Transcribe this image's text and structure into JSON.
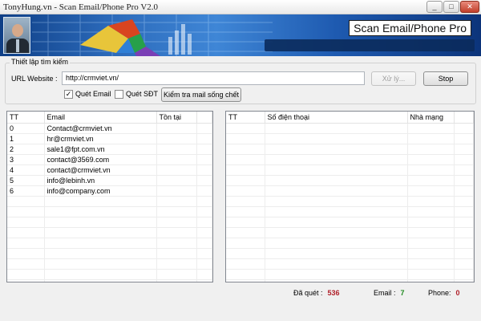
{
  "window": {
    "title": "TonyHung.vn - Scan Email/Phone Pro V2.0",
    "controls": {
      "minimize": "_",
      "maximize": "□",
      "close": "✕"
    }
  },
  "banner": {
    "title": "Scan Email/Phone Pro"
  },
  "search": {
    "group_label": "Thiết lập tìm kiếm",
    "url_label": "URL Website :",
    "url_value": "http://crmviet.vn/",
    "process_button": "Xử lý...",
    "stop_button": "Stop",
    "scan_email_label": "Quét Email",
    "scan_email_checked": true,
    "scan_phone_label": "Quét SĐT",
    "scan_phone_checked": false,
    "check_mail_button": "Kiểm tra mail sống chết"
  },
  "email_table": {
    "columns": [
      "TT",
      "Email",
      "Tồn tại"
    ],
    "rows": [
      [
        "0",
        "Contact@crmviet.vn",
        ""
      ],
      [
        "1",
        "hr@crmviet.vn",
        ""
      ],
      [
        "2",
        "sale1@fpt.com.vn",
        ""
      ],
      [
        "3",
        "contact@3569.com",
        ""
      ],
      [
        "4",
        "contact@crmviet.vn",
        ""
      ],
      [
        "5",
        "info@lebinh.vn",
        ""
      ],
      [
        "6",
        "info@company.com",
        ""
      ]
    ]
  },
  "phone_table": {
    "columns": [
      "TT",
      "Số điện thoại",
      "Nhà mạng"
    ],
    "rows": []
  },
  "status": {
    "scanned_label": "Đã quét :",
    "scanned_value": "536",
    "email_label": "Email :",
    "email_value": "7",
    "phone_label": "Phone:",
    "phone_value": "0"
  },
  "icons": {
    "checkbox_checked": "check-icon",
    "window_close": "close-icon"
  },
  "colors": {
    "banner_start": "#0f3f86",
    "banner_end": "#0c347a",
    "scanned_value": "#b0202a",
    "email_value": "#1f8a1f",
    "phone_value": "#b0202a"
  }
}
